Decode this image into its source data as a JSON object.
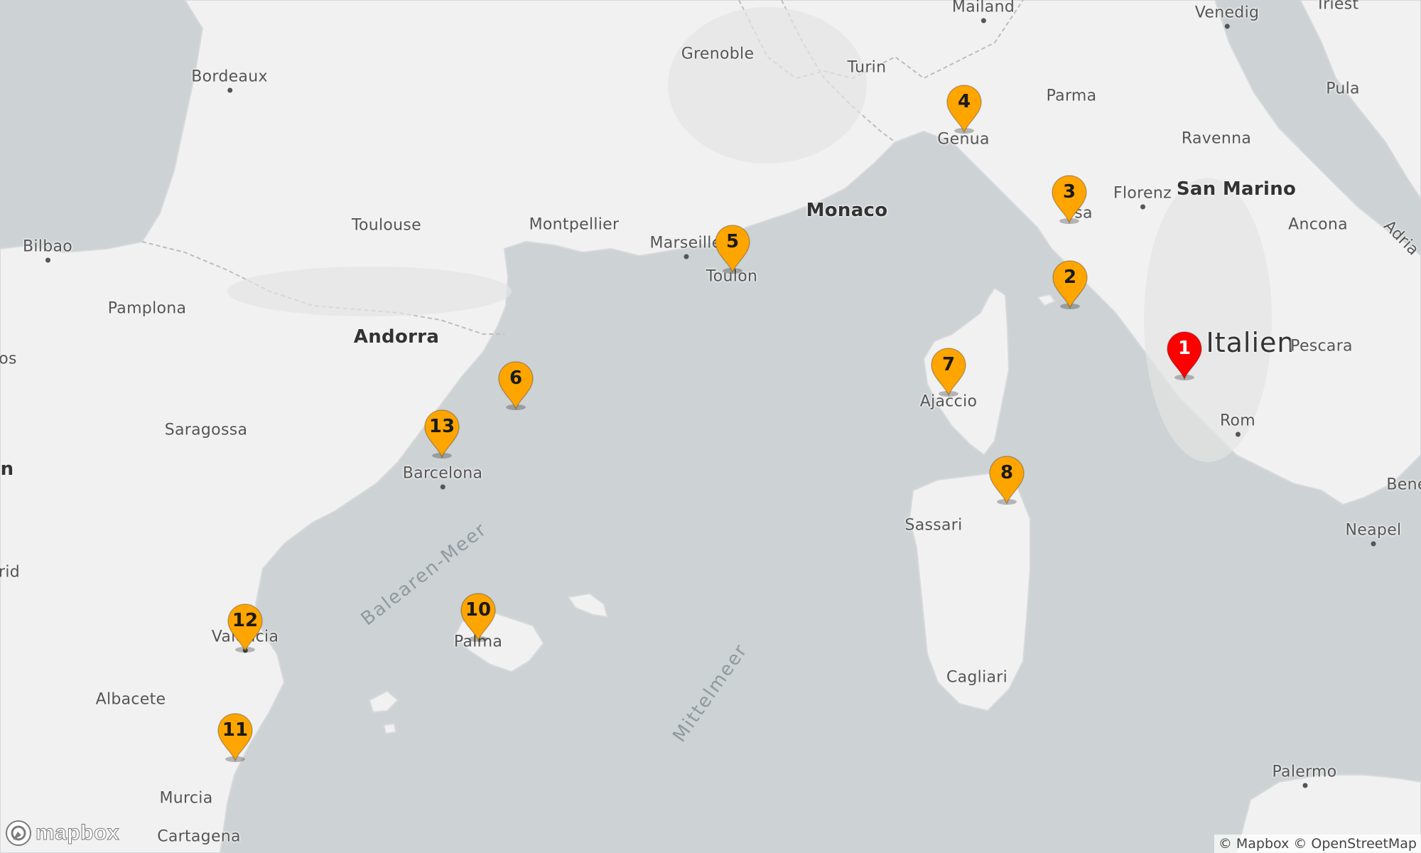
{
  "map": {
    "labels": [
      {
        "id": "mailand",
        "text": "Mailand",
        "dotted": true
      },
      {
        "id": "venedig",
        "text": "Venedig",
        "dotted": true
      },
      {
        "id": "triest",
        "text": "Triest"
      },
      {
        "id": "grenoble",
        "text": "Grenoble"
      },
      {
        "id": "turin",
        "text": "Turin"
      },
      {
        "id": "parma",
        "text": "Parma"
      },
      {
        "id": "pula",
        "text": "Pula"
      },
      {
        "id": "bordeaux",
        "text": "Bordeaux",
        "dotted": true
      },
      {
        "id": "ravenna",
        "text": "Ravenna"
      },
      {
        "id": "genua",
        "text": "Genua"
      },
      {
        "id": "florenz",
        "text": "Florenz",
        "dotted": true
      },
      {
        "id": "san-marino",
        "text": "San Marino",
        "big": true
      },
      {
        "id": "monaco",
        "text": "Monaco",
        "big": true
      },
      {
        "id": "ancona",
        "text": "Ancona"
      },
      {
        "id": "adria",
        "text": "Adria"
      },
      {
        "id": "toulouse",
        "text": "Toulouse"
      },
      {
        "id": "montpellier",
        "text": "Montpellier"
      },
      {
        "id": "bilbao",
        "text": "Bilbao",
        "dotted": true
      },
      {
        "id": "marseille",
        "text": "Marseille",
        "dotted": true
      },
      {
        "id": "pisa",
        "text": "sa"
      },
      {
        "id": "toulon",
        "text": "Toulon"
      },
      {
        "id": "pamplona",
        "text": "Pamplona"
      },
      {
        "id": "andorra",
        "text": "Andorra",
        "big": true
      },
      {
        "id": "italien",
        "text": "Italien",
        "huge": true
      },
      {
        "id": "pescara",
        "text": "Pescara"
      },
      {
        "id": "os",
        "text": "os"
      },
      {
        "id": "ajaccio",
        "text": "Ajaccio"
      },
      {
        "id": "rom",
        "text": "Rom",
        "dotted": true
      },
      {
        "id": "saragossa",
        "text": "Saragossa"
      },
      {
        "id": "n",
        "text": "n",
        "big": true
      },
      {
        "id": "barcelona",
        "text": "Barcelona",
        "dotted": true
      },
      {
        "id": "bene",
        "text": "Bene"
      },
      {
        "id": "sassari",
        "text": "Sassari"
      },
      {
        "id": "neapel",
        "text": "Neapel",
        "dotted": true
      },
      {
        "id": "rid",
        "text": "rid"
      },
      {
        "id": "valencia",
        "text": "Valencia",
        "dotted": true
      },
      {
        "id": "palma",
        "text": "Palma"
      },
      {
        "id": "cagliari",
        "text": "Cagliari"
      },
      {
        "id": "albacete",
        "text": "Albacete"
      },
      {
        "id": "palermo",
        "text": "Palermo",
        "dotted": true
      },
      {
        "id": "murcia",
        "text": "Murcia"
      },
      {
        "id": "cartagena",
        "text": "Cartagena"
      },
      {
        "id": "balearen-meer",
        "text": "Balearen-Meer",
        "sea": true
      },
      {
        "id": "mittelmeer",
        "text": "Mittelmeer",
        "sea": true
      }
    ],
    "markers": [
      {
        "id": "1",
        "label": "1",
        "color": "#ff0000"
      },
      {
        "id": "2",
        "label": "2",
        "color": "#ffa500"
      },
      {
        "id": "3",
        "label": "3",
        "color": "#ffa500"
      },
      {
        "id": "4",
        "label": "4",
        "color": "#ffa500"
      },
      {
        "id": "5",
        "label": "5",
        "color": "#ffa500"
      },
      {
        "id": "6",
        "label": "6",
        "color": "#ffa500"
      },
      {
        "id": "7",
        "label": "7",
        "color": "#ffa500"
      },
      {
        "id": "8",
        "label": "8",
        "color": "#ffa500"
      },
      {
        "id": "10",
        "label": "10",
        "color": "#ffa500"
      },
      {
        "id": "11",
        "label": "11",
        "color": "#ffa500"
      },
      {
        "id": "12",
        "label": "12",
        "color": "#ffa500"
      },
      {
        "id": "13",
        "label": "13",
        "color": "#ffa500"
      }
    ]
  },
  "logo": {
    "text": "mapbox"
  },
  "attribution": {
    "mapbox": "© Mapbox",
    "osm": "© OpenStreetMap"
  },
  "colors": {
    "sea": "#cdd2d4",
    "land": "#f1f1f1",
    "marker_orange": "#ffa500",
    "marker_red": "#ff0000"
  }
}
